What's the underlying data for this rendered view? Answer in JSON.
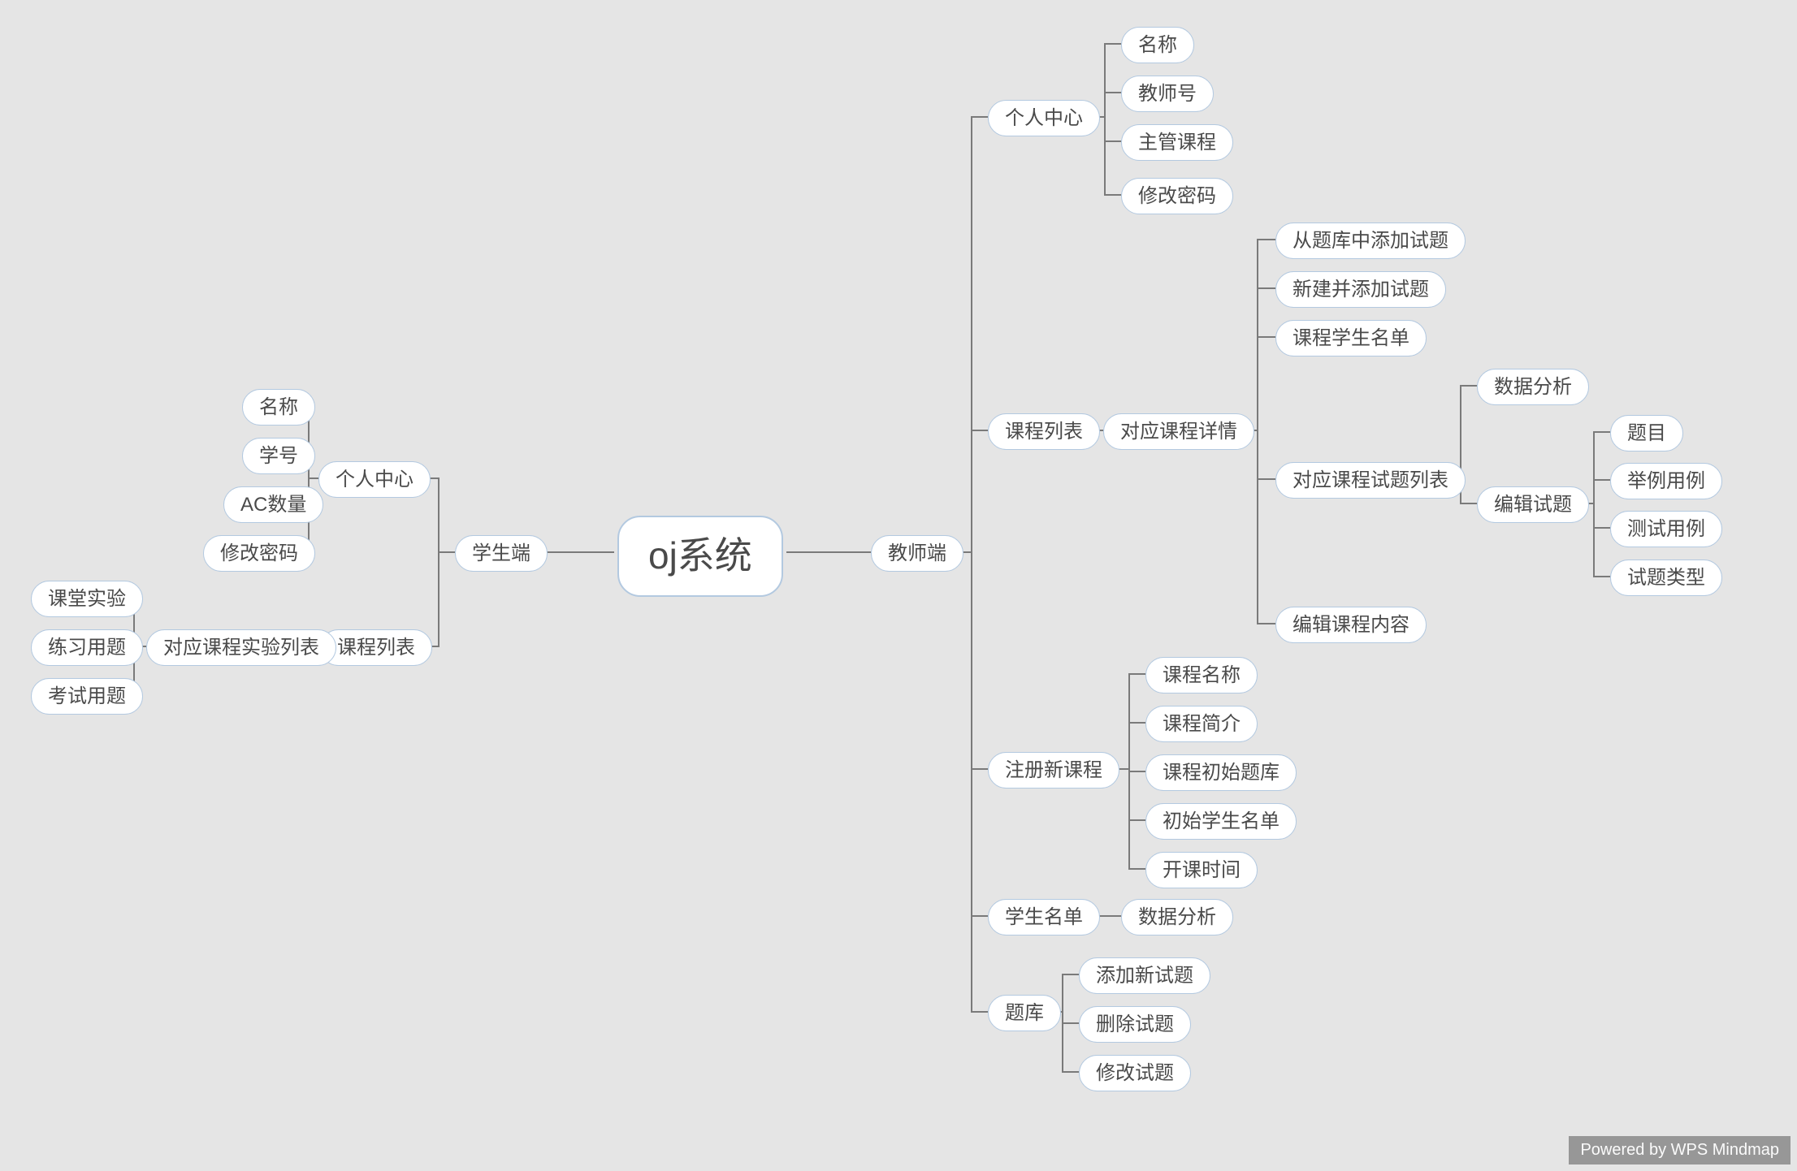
{
  "diagram": {
    "root": {
      "id": "root",
      "label": "oj系统"
    },
    "student": {
      "id": "student",
      "label": "学生端"
    },
    "sPC": {
      "id": "sPC",
      "label": "个人中心"
    },
    "sName": {
      "id": "sName",
      "label": "名称"
    },
    "sNo": {
      "id": "sNo",
      "label": "学号"
    },
    "sAC": {
      "id": "sAC",
      "label": "AC数量"
    },
    "sPwd": {
      "id": "sPwd",
      "label": "修改密码"
    },
    "sCourses": {
      "id": "sCourses",
      "label": "课程列表"
    },
    "sExpList": {
      "id": "sExpList",
      "label": "对应课程实验列表"
    },
    "sClass": {
      "id": "sClass",
      "label": "课堂实验"
    },
    "sPrac": {
      "id": "sPrac",
      "label": "练习用题"
    },
    "sExam": {
      "id": "sExam",
      "label": "考试用题"
    },
    "teacher": {
      "id": "teacher",
      "label": "教师端"
    },
    "tPC": {
      "id": "tPC",
      "label": "个人中心"
    },
    "tName": {
      "id": "tName",
      "label": "名称"
    },
    "tNo": {
      "id": "tNo",
      "label": "教师号"
    },
    "tMain": {
      "id": "tMain",
      "label": "主管课程"
    },
    "tPwd": {
      "id": "tPwd",
      "label": "修改密码"
    },
    "tCourses": {
      "id": "tCourses",
      "label": "课程列表"
    },
    "tDetail": {
      "id": "tDetail",
      "label": "对应课程详情"
    },
    "tAddFromBank": {
      "id": "tAddFromBank",
      "label": "从题库中添加试题"
    },
    "tNewAdd": {
      "id": "tNewAdd",
      "label": "新建并添加试题"
    },
    "tStuList": {
      "id": "tStuList",
      "label": "课程学生名单"
    },
    "tQList": {
      "id": "tQList",
      "label": "对应课程试题列表"
    },
    "tEditQ": {
      "id": "tEditQ",
      "label": "编辑试题"
    },
    "tAnalysis": {
      "id": "tAnalysis",
      "label": "数据分析"
    },
    "tEditCourse": {
      "id": "tEditCourse",
      "label": "编辑课程内容"
    },
    "tQTitle": {
      "id": "tQTitle",
      "label": "题目"
    },
    "tQEx": {
      "id": "tQEx",
      "label": "举例用例"
    },
    "tQTest": {
      "id": "tQTest",
      "label": "测试用例"
    },
    "tQType": {
      "id": "tQType",
      "label": "试题类型"
    },
    "tReg": {
      "id": "tReg",
      "label": "注册新课程"
    },
    "tCName": {
      "id": "tCName",
      "label": "课程名称"
    },
    "tCDesc": {
      "id": "tCDesc",
      "label": "课程简介"
    },
    "tCBank": {
      "id": "tCBank",
      "label": "课程初始题库"
    },
    "tCStu": {
      "id": "tCStu",
      "label": "初始学生名单"
    },
    "tCTime": {
      "id": "tCTime",
      "label": "开课时间"
    },
    "tStuAll": {
      "id": "tStuAll",
      "label": "学生名单"
    },
    "tStuAna": {
      "id": "tStuAna",
      "label": "数据分析"
    },
    "tBank": {
      "id": "tBank",
      "label": "题库"
    },
    "tBAdd": {
      "id": "tBAdd",
      "label": "添加新试题"
    },
    "tBDel": {
      "id": "tBDel",
      "label": "删除试题"
    },
    "tBMod": {
      "id": "tBMod",
      "label": "修改试题"
    }
  },
  "watermark": "Powered by WPS Mindmap",
  "colors": {
    "nodeBorder": "#b3c9e0",
    "nodeBg": "#ffffff",
    "line": "#7a7a7a"
  }
}
